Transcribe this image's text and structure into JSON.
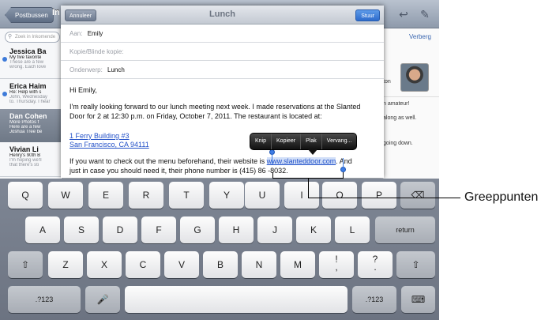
{
  "topbar": {
    "back_label": "Postbussen",
    "inbox_title": "In"
  },
  "sidebar": {
    "search_placeholder": "Zoek in Inkomende",
    "messages": [
      {
        "name": "Jessica Ba",
        "subject": "My five favorite",
        "preview": "These are a few",
        "preview2": "wrong. Each love",
        "unread": true
      },
      {
        "name": "Erica Haim",
        "subject": "Re: Help with s",
        "preview": "John, Wednesday",
        "preview2": "to. Thursday. I hear",
        "unread": true
      },
      {
        "name": "Dan Cohen",
        "subject": "More Photos f",
        "preview": "Here are a few",
        "preview2": "Joshua Tree be",
        "unread": false
      },
      {
        "name": "Vivian Li",
        "subject": "Henry's 90th B",
        "preview": "I'm hoping we'll",
        "preview2": "that there's sti",
        "unread": false
      }
    ]
  },
  "detail": {
    "hide_label": "Verberg",
    "name_fragment": "ton",
    "line1": "n amateur!",
    "line2": "along as well.",
    "line3": "going down."
  },
  "compose": {
    "cancel_label": "Annuleer",
    "title": "Lunch",
    "send_label": "Stuur",
    "to_label": "Aan:",
    "to_value": "Emily",
    "cc_label": "Kopie/Blinde kopie:",
    "subject_label": "Onderwerp:",
    "subject_value": "Lunch",
    "greeting": "Hi Emily,",
    "para1_line1": "I'm really looking forward to our lunch meeting next week. I made reservations at the Slanted",
    "para1_line2": "Door for 2 at 12:30 p.m. on Friday, October 7, 2011. The restaurant is located at:",
    "address1": "1 Ferry Building #3",
    "address2": "San Francisco, CA 94111",
    "para2_pre": "If you want to check out the menu beforehand, their website is ",
    "website": "www.slanteddoor.com",
    "para2_post": ". And",
    "para3": "just in case you should need it, their phone number is (415) 86 -8032."
  },
  "edit_menu": [
    "Knip",
    "Kopieer",
    "Plak",
    "Vervang..."
  ],
  "keyboard": {
    "row1": [
      "Q",
      "W",
      "E",
      "R",
      "T",
      "Y",
      "U",
      "I",
      "O",
      "P"
    ],
    "row2": [
      "A",
      "S",
      "D",
      "F",
      "G",
      "H",
      "J",
      "K",
      "L"
    ],
    "row3": [
      "Z",
      "X",
      "C",
      "V",
      "B",
      "N",
      "M"
    ],
    "return_label": "return",
    "numbers_label": ".?123",
    "excl": "!",
    "quest": "?",
    "comma": ",",
    "period": "."
  },
  "callout": {
    "label": "Greeppunten"
  }
}
